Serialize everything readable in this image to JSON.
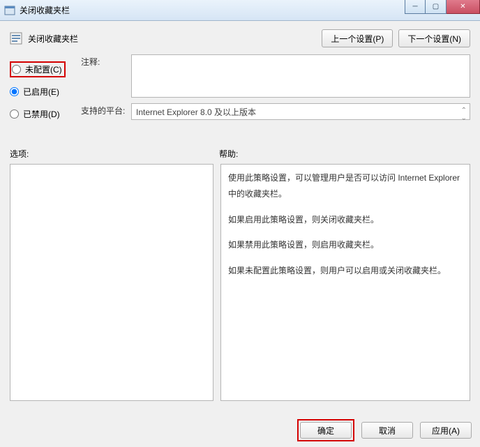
{
  "window": {
    "title": "关闭收藏夹栏"
  },
  "header": {
    "heading": "关闭收藏夹栏",
    "prev": "上一个设置(P)",
    "next": "下一个设置(N)"
  },
  "radios": {
    "not_configured": "未配置(C)",
    "enabled": "已启用(E)",
    "disabled": "已禁用(D)",
    "selected": "enabled"
  },
  "labels": {
    "comment": "注释:",
    "platform": "支持的平台:",
    "options": "选项:",
    "help": "帮助:"
  },
  "fields": {
    "comment_value": "",
    "platform_value": "Internet Explorer 8.0 及以上版本"
  },
  "help": {
    "p1": "使用此策略设置，可以管理用户是否可以访问 Internet Explorer 中的收藏夹栏。",
    "p2": "如果启用此策略设置，则关闭收藏夹栏。",
    "p3": "如果禁用此策略设置，则启用收藏夹栏。",
    "p4": "如果未配置此策略设置，则用户可以启用或关闭收藏夹栏。"
  },
  "footer": {
    "ok": "确定",
    "cancel": "取消",
    "apply": "应用(A)"
  }
}
